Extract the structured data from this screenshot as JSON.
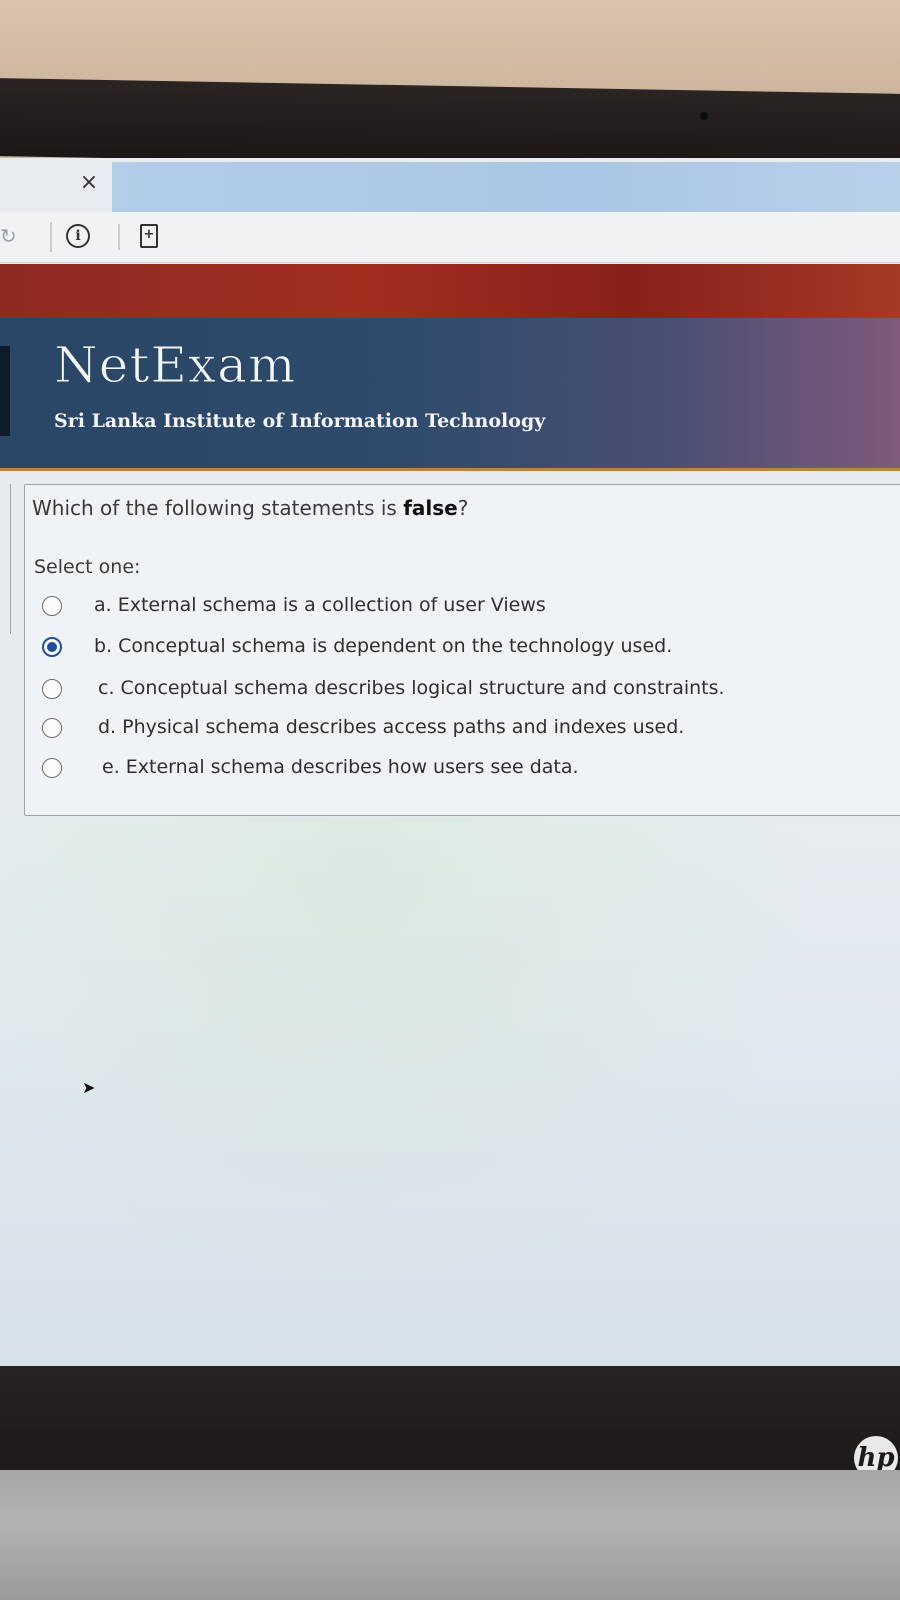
{
  "browser": {
    "tab_close_glyph": "×",
    "icons": [
      "reload-icon",
      "info-icon",
      "page-icon"
    ]
  },
  "header": {
    "brand": "NetExam",
    "institute": "Sri Lanka Institute of Information Technology"
  },
  "question": {
    "text_before": "Which of the following statements is ",
    "text_emphasis": "false",
    "text_after": "?",
    "select_label": "Select one:",
    "options": [
      {
        "label": "a. External schema is a collection of user Views",
        "checked": false
      },
      {
        "label": "b. Conceptual schema is dependent on the technology used.",
        "checked": true
      },
      {
        "label": "c. Conceptual schema describes logical structure and constraints.",
        "checked": false
      },
      {
        "label": "d. Physical schema describes access paths and indexes used.",
        "checked": false
      },
      {
        "label": "e. External schema describes how users see data.",
        "checked": false
      }
    ]
  },
  "device": {
    "logo_text": "hp"
  }
}
